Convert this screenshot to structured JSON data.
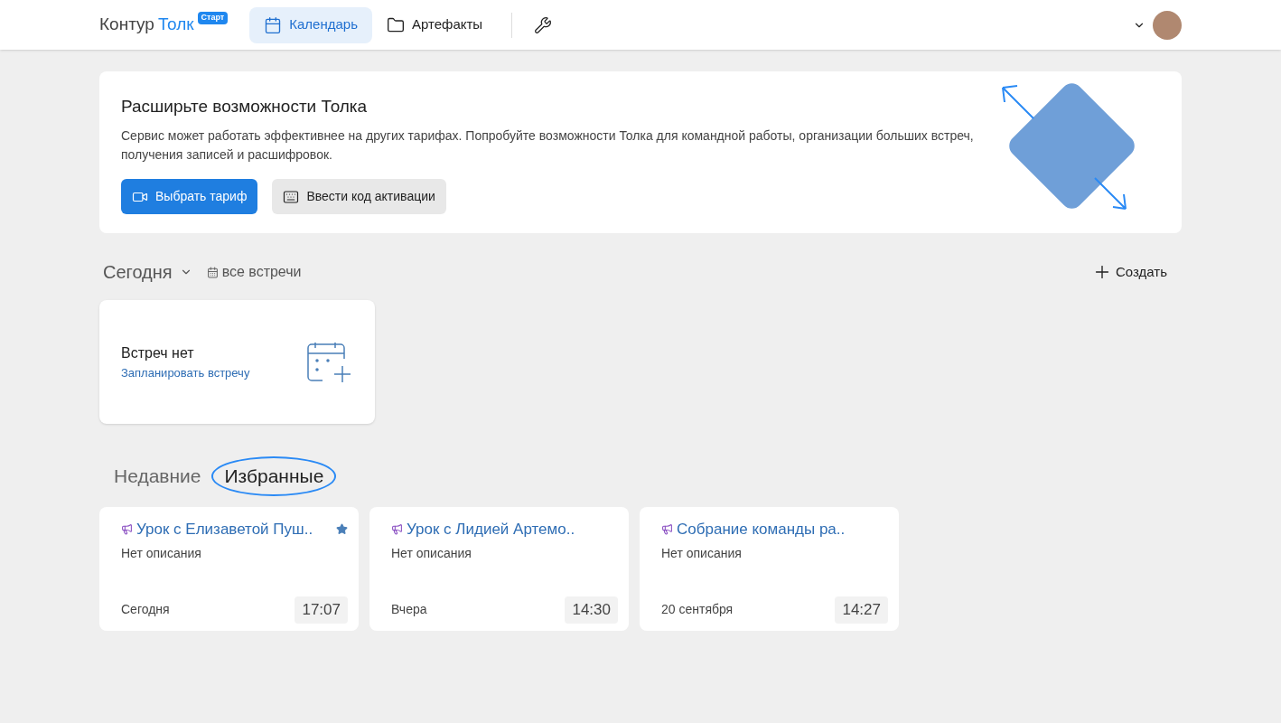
{
  "header": {
    "logo": {
      "brand": "Контур",
      "product": "Толк",
      "badge": "Старт"
    },
    "nav": [
      {
        "label": "Календарь",
        "selected": true
      },
      {
        "label": "Артефакты",
        "selected": false
      }
    ]
  },
  "promo": {
    "title": "Расширьте возможности Толка",
    "text": "Сервис может работать эффективнее на других тарифах. Попробуйте возможности Толка для командной работы, организации больших встреч, получения записей и расшифровок.",
    "buttons": [
      {
        "label": "Выбрать тариф",
        "kind": "primary"
      },
      {
        "label": "Ввести код активации",
        "kind": "secondary"
      }
    ]
  },
  "meetings": {
    "period": "Сегодня",
    "all_link": "все встречи",
    "create": "Создать",
    "empty_title": "Встреч нет",
    "empty_link": "Запланировать встречу"
  },
  "tabs": [
    {
      "label": "Недавние",
      "selected": false
    },
    {
      "label": "Избранные",
      "selected": true
    }
  ],
  "cards": [
    {
      "title": "Урок с Елизаветой Пуш..",
      "description": "Нет описания",
      "date": "Сегодня",
      "time": "17:07",
      "favorite": true
    },
    {
      "title": "Урок с Лидией Артемо..",
      "description": "Нет описания",
      "date": "Вчера",
      "time": "14:30",
      "favorite": false
    },
    {
      "title": "Собрание команды ра..",
      "description": "Нет описания",
      "date": "20 сентября",
      "time": "14:27",
      "favorite": false
    }
  ]
}
